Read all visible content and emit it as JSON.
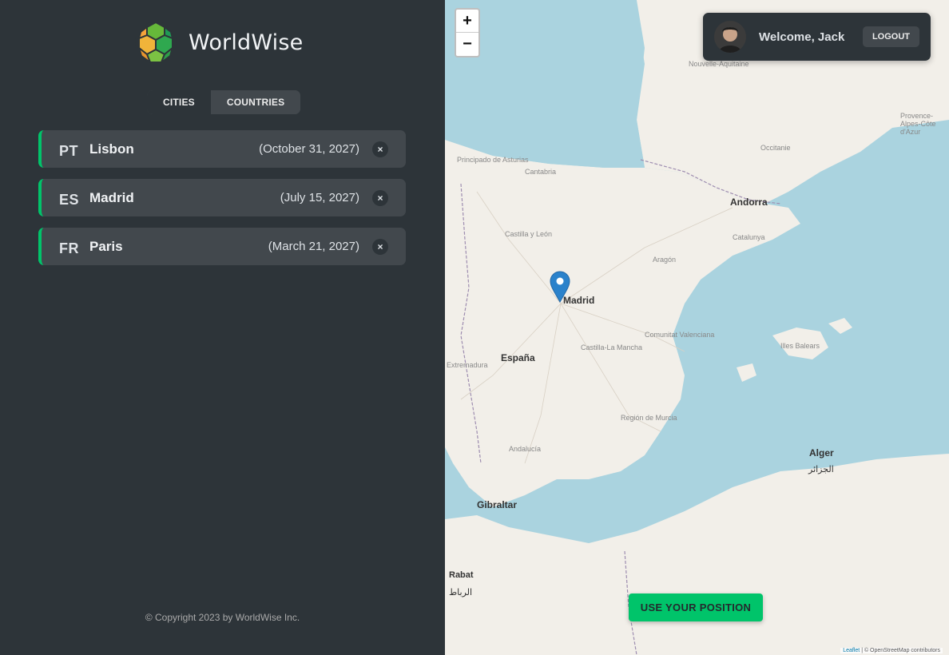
{
  "app": {
    "name": "WorldWise"
  },
  "tabs": [
    {
      "label": "CITIES"
    },
    {
      "label": "COUNTRIES"
    }
  ],
  "cities": [
    {
      "code": "PT",
      "name": "Lisbon",
      "date": "(October 31, 2027)",
      "delete": "×"
    },
    {
      "code": "ES",
      "name": "Madrid",
      "date": "(July 15, 2027)",
      "delete": "×"
    },
    {
      "code": "FR",
      "name": "Paris",
      "date": "(March 21, 2027)",
      "delete": "×"
    }
  ],
  "footer": {
    "copyright": "© Copyright 2023 by WorldWise Inc."
  },
  "map": {
    "zoom_in": "+",
    "zoom_out": "−",
    "labels": {
      "andorra": "Andorra",
      "madrid": "Madrid",
      "espana": "España",
      "gibraltar": "Gibraltar",
      "alger": "Alger",
      "alger_ar": "الجزائر",
      "rabat": "Rabat",
      "rabat_ar": "الرباط"
    },
    "small_labels": {
      "asturias": "Principado de Asturias",
      "cantabria": "Cantabria",
      "castilla_leon": "Castilla y León",
      "aragon": "Aragón",
      "catalunya": "Catalunya",
      "extremadura": "Extremadura",
      "castilla_mancha": "Castilla-La Mancha",
      "valenciana": "Comunitat Valenciana",
      "murcia": "Región de Murcia",
      "andalucia": "Andalucía",
      "illes_balears": "Illes Balears",
      "occitanie": "Occitanie",
      "aquitaine": "Nouvelle-Aquitaine",
      "provence": "Provence-Alpes-Côte d'Azur"
    },
    "attribution_leaflet": "Leaflet",
    "attribution_rest": "| © OpenStreetMap contributors",
    "colors": {
      "sea": "#aad3df",
      "land": "#f2efe9",
      "marker": "#2b82cb"
    }
  },
  "user": {
    "welcome": "Welcome, Jack",
    "logout": "LOGOUT"
  },
  "use_position": "USE YOUR POSITION",
  "colors": {
    "accent": "#00c46a",
    "sidebar_bg": "#2d3439",
    "card_bg": "#42484d"
  }
}
